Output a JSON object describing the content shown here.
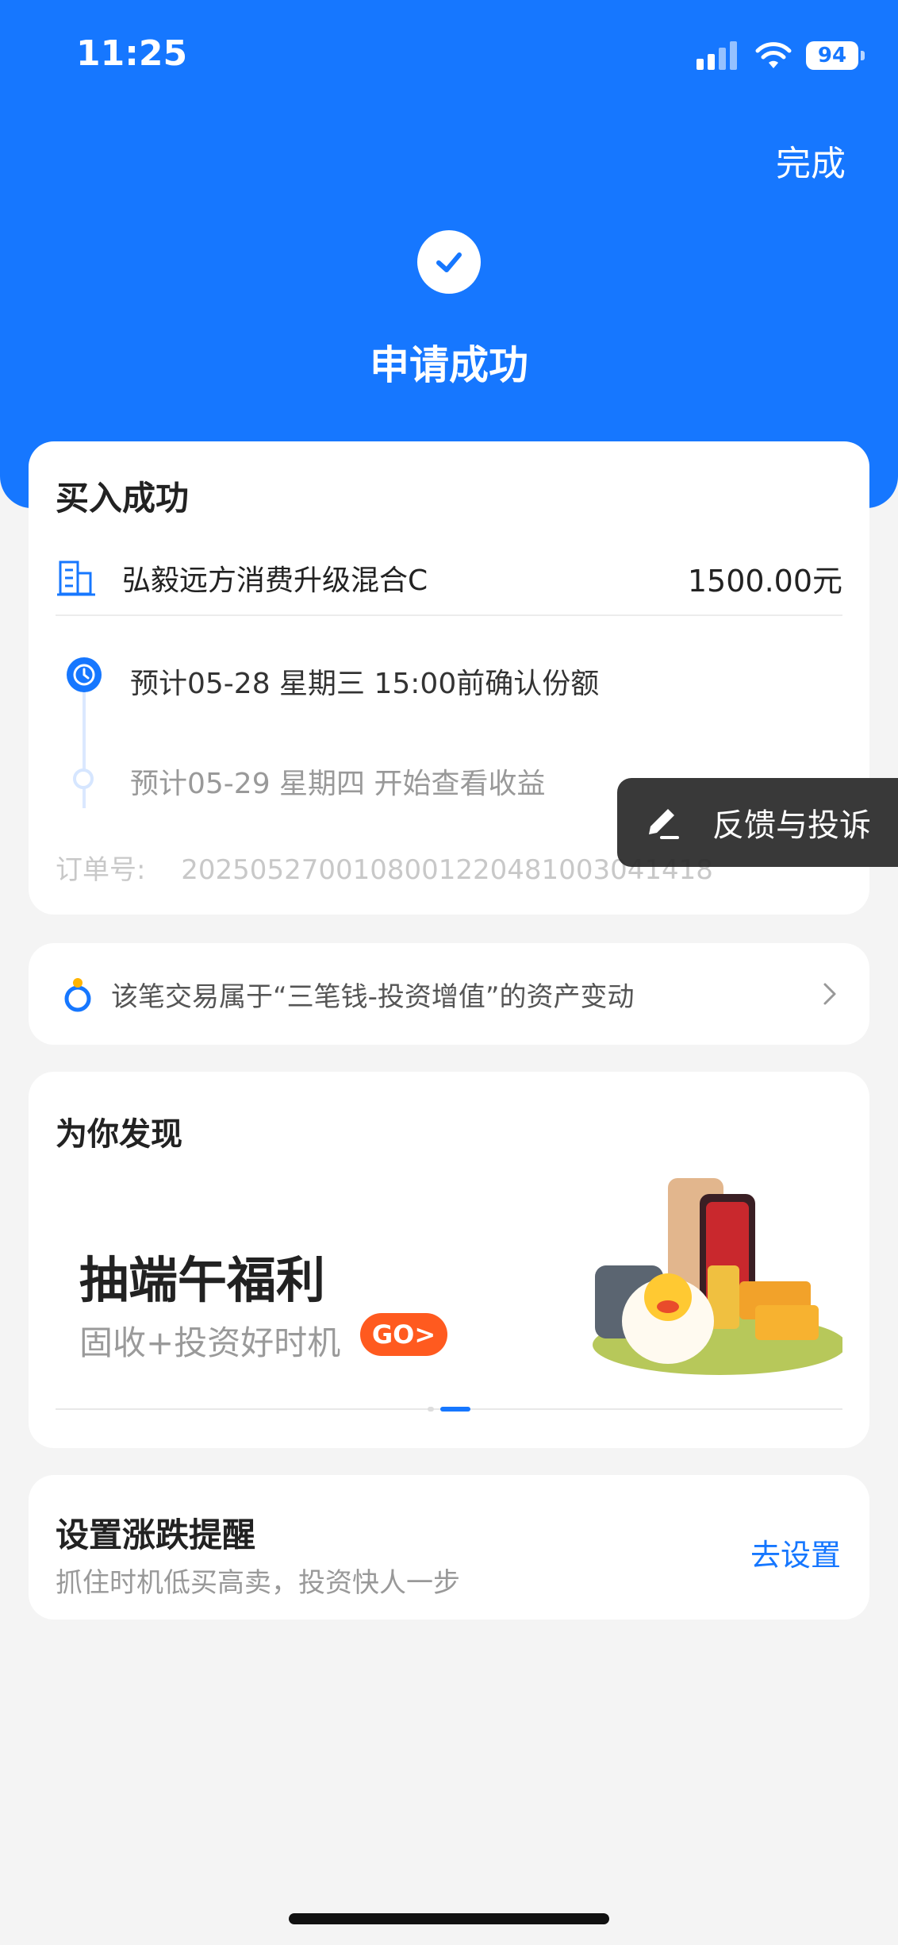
{
  "status_bar": {
    "time": "11:25",
    "battery": "94"
  },
  "header": {
    "done_label": "完成",
    "title": "申请成功"
  },
  "purchase": {
    "title": "买入成功",
    "fund_name": "弘毅远方消费升级混合C",
    "amount": "1500.00元",
    "timeline": [
      {
        "text": "预计05-28 星期三 15:00前确认份额"
      },
      {
        "text": "预计05-29 星期四 开始查看收益"
      }
    ],
    "order_label": "订单号:",
    "order_number": "2025052700108001220481003041418"
  },
  "feedback": {
    "label": "反馈与投诉"
  },
  "asset_notice": {
    "text": "该笔交易属于“三笔钱-投资增值”的资产变动"
  },
  "discover": {
    "title": "为你发现",
    "banner": {
      "title": "抽端午福利",
      "subtitle": "固收+投资好时机",
      "go_label": "GO>"
    }
  },
  "reminder": {
    "title": "设置涨跌提醒",
    "subtitle": "抓住时机低买高卖，投资快人一步",
    "action_label": "去设置"
  },
  "colors": {
    "primary": "#1677ff",
    "background": "#f4f4f4",
    "go": "#ff5a1f"
  }
}
